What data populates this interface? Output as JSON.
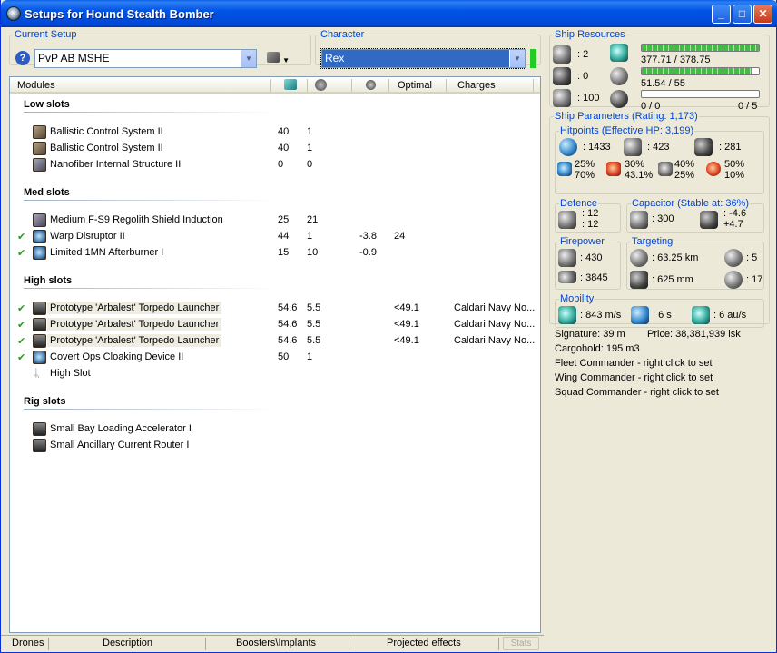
{
  "window": {
    "title": "Setups for Hound Stealth Bomber"
  },
  "current_setup": {
    "legend": "Current Setup",
    "value": "PvP AB MSHE"
  },
  "character": {
    "legend": "Character",
    "value": "Rex"
  },
  "modules_table": {
    "headers": [
      "Modules",
      "Optimal",
      "Charges"
    ],
    "sections": [
      {
        "title": "Low slots",
        "rows": [
          {
            "name": "Ballistic Control System II",
            "c1": "40",
            "c2": "1",
            "c3": "",
            "c4": "",
            "c5": "",
            "check": false
          },
          {
            "name": "Ballistic Control System II",
            "c1": "40",
            "c2": "1",
            "c3": "",
            "c4": "",
            "c5": "",
            "check": false
          },
          {
            "name": "Nanofiber Internal Structure II",
            "c1": "0",
            "c2": "0",
            "c3": "",
            "c4": "",
            "c5": "",
            "check": false
          }
        ]
      },
      {
        "title": "Med slots",
        "rows": [
          {
            "name": "Medium F-S9 Regolith Shield Induction",
            "c1": "25",
            "c2": "21",
            "c3": "",
            "c4": "",
            "c5": "",
            "check": false
          },
          {
            "name": "Warp Disruptor II",
            "c1": "44",
            "c2": "1",
            "c3": "-3.8",
            "c4": "24",
            "c5": "",
            "check": true
          },
          {
            "name": "Limited 1MN Afterburner I",
            "c1": "15",
            "c2": "10",
            "c3": "-0.9",
            "c4": "",
            "c5": "",
            "check": true
          }
        ]
      },
      {
        "title": "High slots",
        "rows": [
          {
            "name": "Prototype 'Arbalest' Torpedo Launcher",
            "c1": "54.6",
            "c2": "5.5",
            "c3": "",
            "c4": "<49.1",
            "c5": "Caldari Navy No...",
            "check": true
          },
          {
            "name": "Prototype 'Arbalest' Torpedo Launcher",
            "c1": "54.6",
            "c2": "5.5",
            "c3": "",
            "c4": "<49.1",
            "c5": "Caldari Navy No...",
            "check": true
          },
          {
            "name": "Prototype 'Arbalest' Torpedo Launcher",
            "c1": "54.6",
            "c2": "5.5",
            "c3": "",
            "c4": "<49.1",
            "c5": "Caldari Navy No...",
            "check": true
          },
          {
            "name": "Covert Ops Cloaking Device II",
            "c1": "50",
            "c2": "1",
            "c3": "",
            "c4": "",
            "c5": "",
            "check": true
          },
          {
            "name": "High Slot",
            "c1": "",
            "c2": "",
            "c3": "",
            "c4": "",
            "c5": "",
            "check": false
          }
        ]
      },
      {
        "title": "Rig slots",
        "rows": [
          {
            "name": "Small Bay Loading Accelerator I",
            "c1": "",
            "c2": "",
            "c3": "",
            "c4": "",
            "c5": "",
            "check": false
          },
          {
            "name": "Small Ancillary Current Router I",
            "c1": "",
            "c2": "",
            "c3": "",
            "c4": "",
            "c5": "",
            "check": false
          }
        ]
      }
    ]
  },
  "bottom_tabs": [
    "Drones",
    "Description",
    "Boosters\\Implants",
    "Projected effects",
    "Stats"
  ],
  "ship_resources": {
    "legend": "Ship Resources",
    "turret": ": 2",
    "launcher": ": 0",
    "calibration": ": 100",
    "cpu": "377.71 / 378.75",
    "cpu_fill": 0.997,
    "power": "51.54 / 55",
    "power_fill": 0.937,
    "drone_bw": "0 / 0",
    "drone_count": "0 / 5",
    "drone_fill": 0
  },
  "ship_parameters": {
    "legend": "Ship Parameters (Rating: 1,173)",
    "hitpoints": {
      "legend": "Hitpoints (Effective HP: 3,199)",
      "shield": ": 1433",
      "armor": ": 423",
      "structure": ": 281",
      "em": [
        "25%",
        "70%"
      ],
      "thermal": [
        "30%",
        "43.1%"
      ],
      "kinetic": [
        "40%",
        "25%"
      ],
      "explosive": [
        "50%",
        "10%"
      ]
    },
    "defence": {
      "legend": "Defence",
      "a": ": 12",
      "b": ": 12"
    },
    "capacitor": {
      "legend": "Capacitor (Stable at: 36%)",
      "amount": ": 300",
      "use": ": -4.6",
      "regen": "+4.7"
    },
    "firepower": {
      "legend": "Firepower",
      "dps": ": 430",
      "volley": ": 3845"
    },
    "targeting": {
      "legend": "Targeting",
      "range": ": 63.25 km",
      "scan": ": 625 mm",
      "targets": ": 5",
      "sensor": ": 17"
    },
    "mobility": {
      "legend": "Mobility",
      "speed": ": 843 m/s",
      "align": ": 6 s",
      "warp": ": 6 au/s"
    }
  },
  "info": {
    "signature": "Signature: 39 m",
    "price": "Price: 38,381,939 isk",
    "cargohold": "Cargohold: 195 m3",
    "fleet": "Fleet Commander - right click to set",
    "wing": "Wing Commander - right click to set",
    "squad": "Squad Commander - right click to set"
  }
}
